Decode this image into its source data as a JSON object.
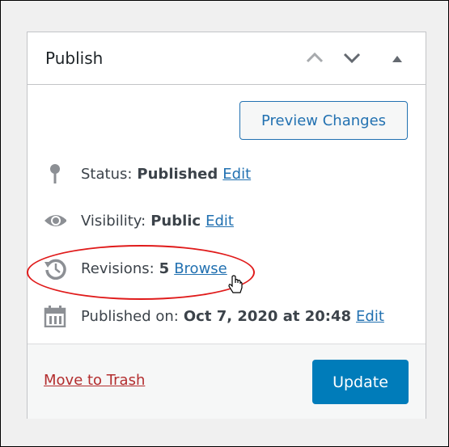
{
  "metabox": {
    "title": "Publish",
    "controls": {
      "move_up": "chevron-up",
      "move_down": "chevron-down",
      "toggle_panel": "triangle-up"
    }
  },
  "preview_button_label": "Preview Changes",
  "misc": {
    "status": {
      "label": "Status:",
      "value": "Published",
      "link": "Edit",
      "icon": "pin-icon"
    },
    "visibility": {
      "label": "Visibility:",
      "value": "Public",
      "link": "Edit",
      "icon": "eye-icon"
    },
    "revisions": {
      "label": "Revisions:",
      "value": "5",
      "link": "Browse",
      "icon": "history-icon"
    },
    "published_on": {
      "label": "Published on:",
      "value": "Oct 7, 2020 at 20:48",
      "link": "Edit",
      "icon": "calendar-icon"
    }
  },
  "footer": {
    "trash_label": "Move to Trash",
    "update_label": "Update"
  },
  "colors": {
    "accent": "#2271b1",
    "primary_button": "#007cba",
    "danger": "#b32d2e",
    "annotation": "#e01b1b"
  }
}
